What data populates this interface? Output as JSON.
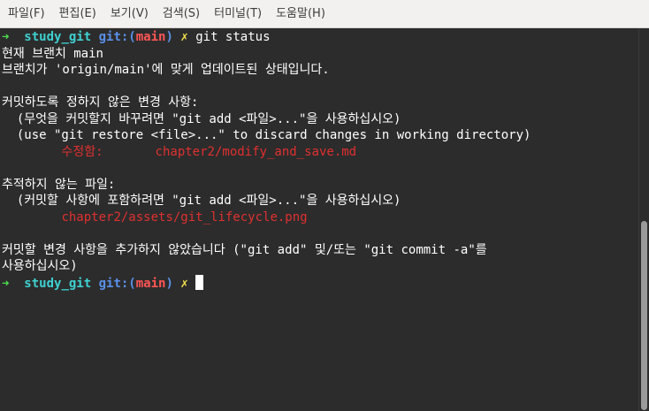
{
  "menu": [
    "파일(F)",
    "편집(E)",
    "보기(V)",
    "검색(S)",
    "터미널(T)",
    "도움말(H)"
  ],
  "prompt": {
    "arrow": "➜",
    "dir": "study_git",
    "git_label": "git:(",
    "branch": "main",
    "git_close": ")",
    "dirty": "✗"
  },
  "command": "git status",
  "output": {
    "l1": "현재 브랜치 main",
    "l2": "브랜치가 'origin/main'에 맞게 업데이트된 상태입니다.",
    "l4": "커밋하도록 정하지 않은 변경 사항:",
    "l5": "  (무엇을 커밋할지 바꾸려면 \"git add <파일>...\"을 사용하십시오)",
    "l6": "  (use \"git restore <file>...\" to discard changes in working directory)",
    "l7_label": "수정함:",
    "l7_file": "chapter2/modify_and_save.md",
    "l9": "추적하지 않는 파일:",
    "l10": "  (커밋할 사항에 포함하려면 \"git add <파일>...\"을 사용하십시오)",
    "l11_file": "chapter2/assets/git_lifecycle.png",
    "l13": "커밋할 변경 사항을 추가하지 않았습니다 (\"git add\" 및/또는 \"git commit -a\"를",
    "l14": "사용하십시오)"
  },
  "colors": {
    "background": "#2c2c2c",
    "arrow": "#4ee04e",
    "dir": "#3fd0d0",
    "git_label": "#5a8fe8",
    "branch": "#ff5555",
    "dirty": "#f5e44a",
    "changed_file": "#e03030"
  }
}
